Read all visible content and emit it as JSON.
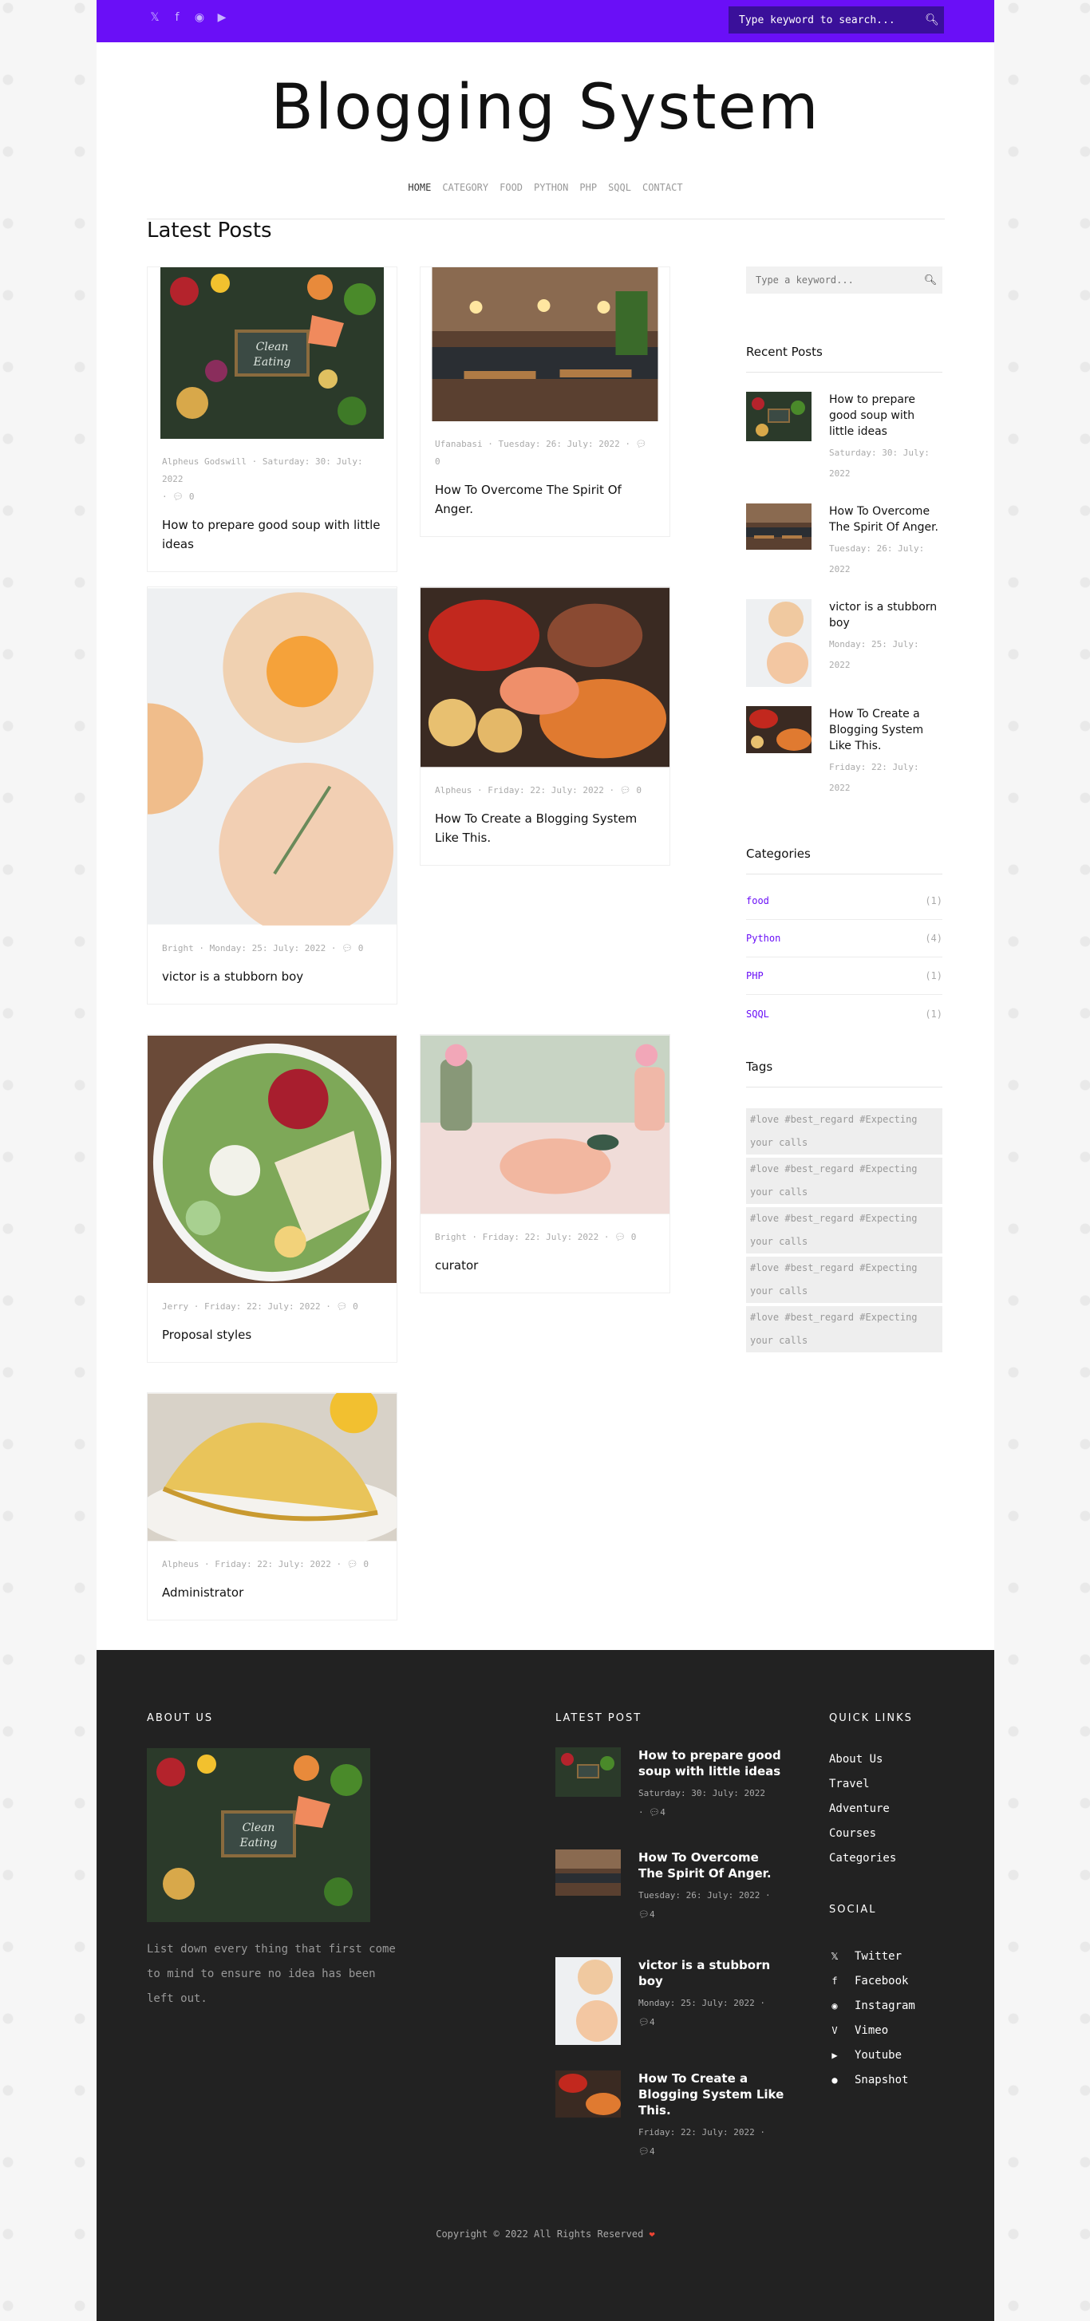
{
  "topbar": {
    "social_icons": [
      "twitter-icon",
      "facebook-icon",
      "instagram-icon",
      "youtube-icon"
    ],
    "search_placeholder": "Type keyword to search..."
  },
  "site": {
    "title": "Blogging System"
  },
  "nav": {
    "items": [
      "HOME",
      "CATEGORY",
      "FOOD",
      "PYTHON",
      "PHP",
      "SQQL",
      "CONTACT"
    ]
  },
  "main": {
    "heading": "Latest Posts",
    "posts": [
      {
        "meta": "Alpheus Godswill · Saturday: 30: July: 2022",
        "comments": "0",
        "title": "How to prepare good soup with little ideas",
        "image": "vegetables-clean-eating"
      },
      {
        "meta": "Ufanabasi · Tuesday: 26: July: 2022",
        "comments": "0",
        "title": "How To Overcome The Spirit Of Anger.",
        "image": "restaurant-interior"
      },
      {
        "meta": "Bright · Monday: 25: July: 2022",
        "comments": "0",
        "title": "victor is a stubborn boy",
        "image": "orange-drinks"
      },
      {
        "meta": "Alpheus · Friday: 22: July: 2022",
        "comments": "0",
        "title": "How To Create a Blogging System Like This.",
        "image": "seafood-platter"
      },
      {
        "meta": "Jerry · Friday: 22: July: 2022",
        "comments": "0",
        "title": "Proposal styles",
        "image": "salad-bowl"
      },
      {
        "meta": "Bright · Friday: 22: July: 2022",
        "comments": "0",
        "title": "curator",
        "image": "pink-table-setting"
      },
      {
        "meta": "Alpheus · Friday: 22: July: 2022",
        "comments": "0",
        "title": "Administrator",
        "image": "empanadas"
      }
    ]
  },
  "sidebar": {
    "search_placeholder": "Type a keyword...",
    "recent_heading": "Recent Posts",
    "recent": [
      {
        "title": "How to prepare good soup with little ideas",
        "date": "Saturday: 30: July: 2022"
      },
      {
        "title": "How To Overcome The Spirit Of Anger.",
        "date": "Tuesday: 26: July: 2022"
      },
      {
        "title": "victor is a stubborn boy",
        "date": "Monday: 25: July: 2022"
      },
      {
        "title": "How To Create a Blogging System Like This.",
        "date": "Friday: 22: July: 2022"
      }
    ],
    "categories_heading": "Categories",
    "categories": [
      {
        "name": "food",
        "count": "(1)"
      },
      {
        "name": "Python",
        "count": "(4)"
      },
      {
        "name": "PHP",
        "count": "(1)"
      },
      {
        "name": "SQQL",
        "count": "(1)"
      }
    ],
    "tags_heading": "Tags",
    "tags": [
      "#love #best_regard #Expecting your calls",
      "#love #best_regard #Expecting your calls",
      "#love #best_regard #Expecting your calls",
      "#love #best_regard #Expecting your calls",
      "#love #best_regard #Expecting your calls"
    ]
  },
  "footer": {
    "about_heading": "ABOUT US",
    "about_text": "List down every thing that first come to mind to ensure no idea has been left out.",
    "latest_heading": "LATEST POST",
    "latest": [
      {
        "title": "How to prepare good soup with little ideas",
        "date": "Saturday: 30: July: 2022",
        "comments": "4"
      },
      {
        "title": "How To Overcome The Spirit Of Anger.",
        "date": "Tuesday: 26: July: 2022",
        "comments": "4"
      },
      {
        "title": "victor is a stubborn boy",
        "date": "Monday: 25: July: 2022",
        "comments": "4"
      },
      {
        "title": "How To Create a Blogging System Like This.",
        "date": "Friday: 22: July: 2022",
        "comments": "4"
      }
    ],
    "quick_heading": "QUICK LINKS",
    "quick_links": [
      "About Us",
      "Travel",
      "Adventure",
      "Courses",
      "Categories"
    ],
    "social_heading": "SOCIAL",
    "social": [
      {
        "label": "Twitter",
        "icon": "twitter-icon"
      },
      {
        "label": "Facebook",
        "icon": "facebook-icon"
      },
      {
        "label": "Instagram",
        "icon": "instagram-icon"
      },
      {
        "label": "Vimeo",
        "icon": "vimeo-icon"
      },
      {
        "label": "Youtube",
        "icon": "youtube-icon"
      },
      {
        "label": "Snapshot",
        "icon": "snapchat-icon"
      }
    ],
    "copyright": "Copyright © 2022 All Rights Reserved"
  },
  "colors": {
    "accent": "#6a0ff7",
    "footer_bg": "#222222"
  }
}
